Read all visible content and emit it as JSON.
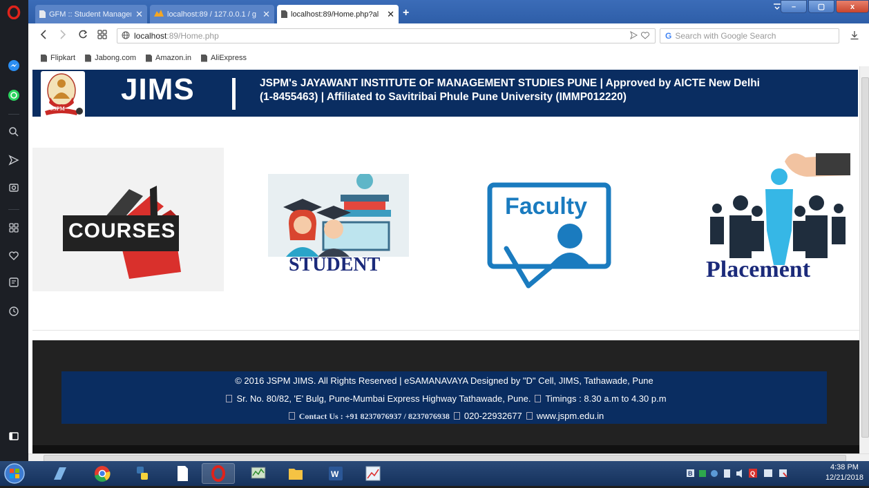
{
  "browser": {
    "tabs": [
      {
        "label": "GFM :: Student Manageme",
        "active": false
      },
      {
        "label": "localhost:89 / 127.0.0.1 / g",
        "active": false
      },
      {
        "label": "localhost:89/Home.php?al",
        "active": true
      }
    ],
    "new_tab": "+",
    "close_glyph": "✕",
    "window_controls": {
      "minimize": "–",
      "maximize": "▢",
      "close": "x"
    },
    "url_host": "localhost",
    "url_path": ":89/Home.php",
    "search_placeholder": "Search with Google Search",
    "bookmarks": [
      "Flipkart",
      "Jabong.com",
      "Amazon.in",
      "AliExpress"
    ]
  },
  "site": {
    "title": "JIMS",
    "header_line1": "JSPM's JAYAWANT INSTITUTE OF MANAGEMENT STUDIES PUNE | Approved by AICTE New Delhi",
    "header_line2": "(1-8455463) | Affiliated to Savitribai Phule Pune University (IMMP012220)",
    "logo_text": "JSPM",
    "tiles": {
      "courses": "COURSES",
      "student": "STUDENT",
      "faculty": "Faculty",
      "placement": "Placement"
    },
    "footer": {
      "line1": "© 2016 JSPM JIMS. All Rights Reserved | eSAMANAVAYA Designed by \"D\" Cell, JIMS, Tathawade, Pune",
      "line2_address": "Sr. No. 80/82, 'E' Bulg, Pune-Mumbai Express Highway Tathawade, Pune.",
      "line2_timings": "Timings : 8.30 a.m to 4.30 p.m",
      "line3_contact": "Contact Us : +91 8237076937 / 8237076938",
      "line3_phone": "020-22932677",
      "line3_web": "www.jspm.edu.in"
    }
  },
  "taskbar": {
    "time": "4:38 PM",
    "date": "12/21/2018"
  },
  "colors": {
    "header_blue": "#0a2d61",
    "footer_dark": "#222222",
    "courses_red": "#d9302c",
    "faculty_blue": "#1a7bbf",
    "placement_cyan": "#36b7e6",
    "label_navy": "#1b2a7a"
  }
}
